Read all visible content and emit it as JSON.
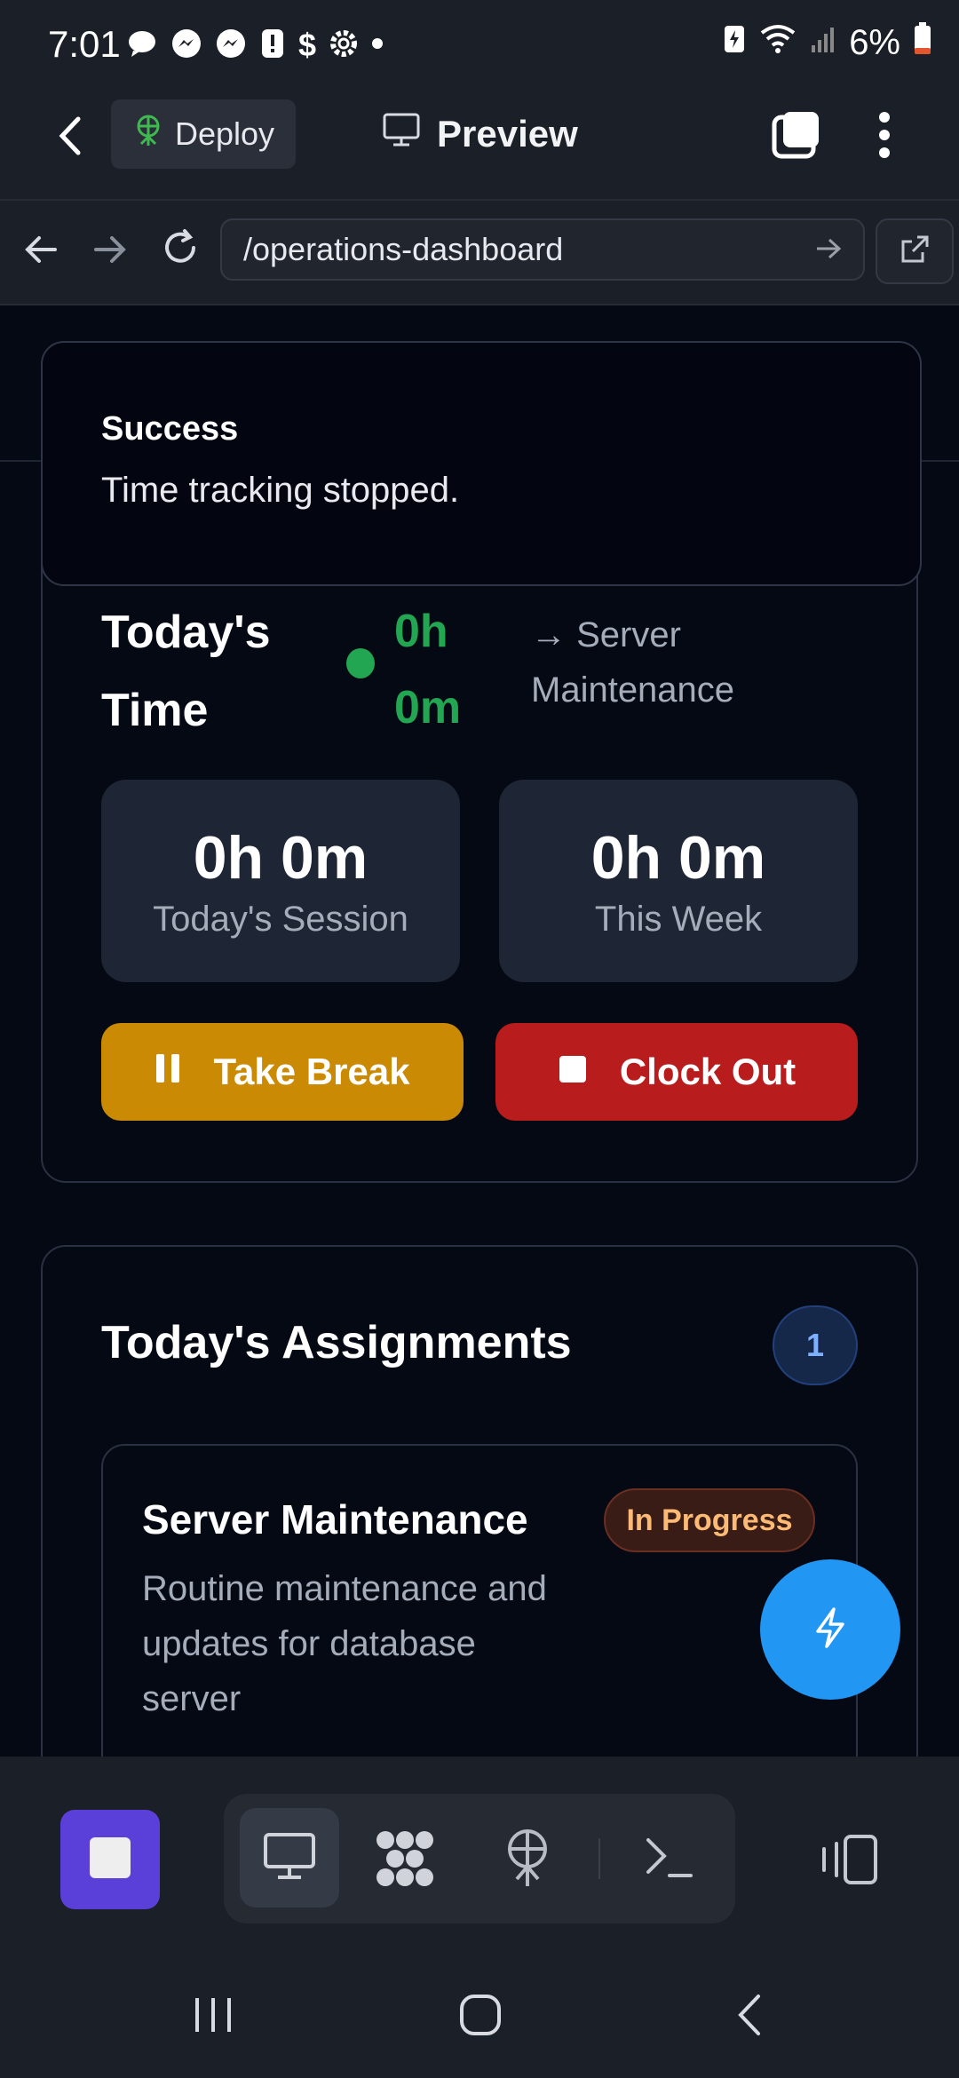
{
  "status_bar": {
    "time": "7:01",
    "battery": "6%",
    "icons": [
      "chat-icon",
      "messenger-icon",
      "messenger-icon",
      "alert-icon",
      "dollar-icon",
      "settings-icon",
      "dot-icon"
    ]
  },
  "app_bar": {
    "deploy_label": "Deploy",
    "preview_label": "Preview"
  },
  "url_bar": {
    "url": "/operations-dashboard"
  },
  "toast": {
    "title": "Success",
    "message": "Time tracking stopped."
  },
  "time_card": {
    "title_line1": "Today's",
    "title_line2": "Time",
    "time_line1": "0h",
    "time_line2": "0m",
    "task_line1": "→ Server",
    "task_line2": "Maintenance",
    "stats": [
      {
        "value": "0h 0m",
        "label": "Today's Session"
      },
      {
        "value": "0h 0m",
        "label": "This Week"
      }
    ],
    "break_label": "Take Break",
    "clockout_label": "Clock Out",
    "colors": {
      "break": "#ca8a04",
      "clockout": "#b91c1c",
      "active": "#22a652"
    }
  },
  "assignments": {
    "title": "Today's Assignments",
    "count": "1",
    "items": [
      {
        "name": "Server Maintenance",
        "status": "In Progress",
        "desc_line1": "Routine maintenance and",
        "desc_line2": "updates for database",
        "desc_line3": "server"
      }
    ]
  },
  "dock": {
    "icons": [
      "stop-icon",
      "monitor-icon",
      "extensions-icon",
      "deploy-icon",
      "terminal-icon",
      "devices-icon"
    ]
  }
}
